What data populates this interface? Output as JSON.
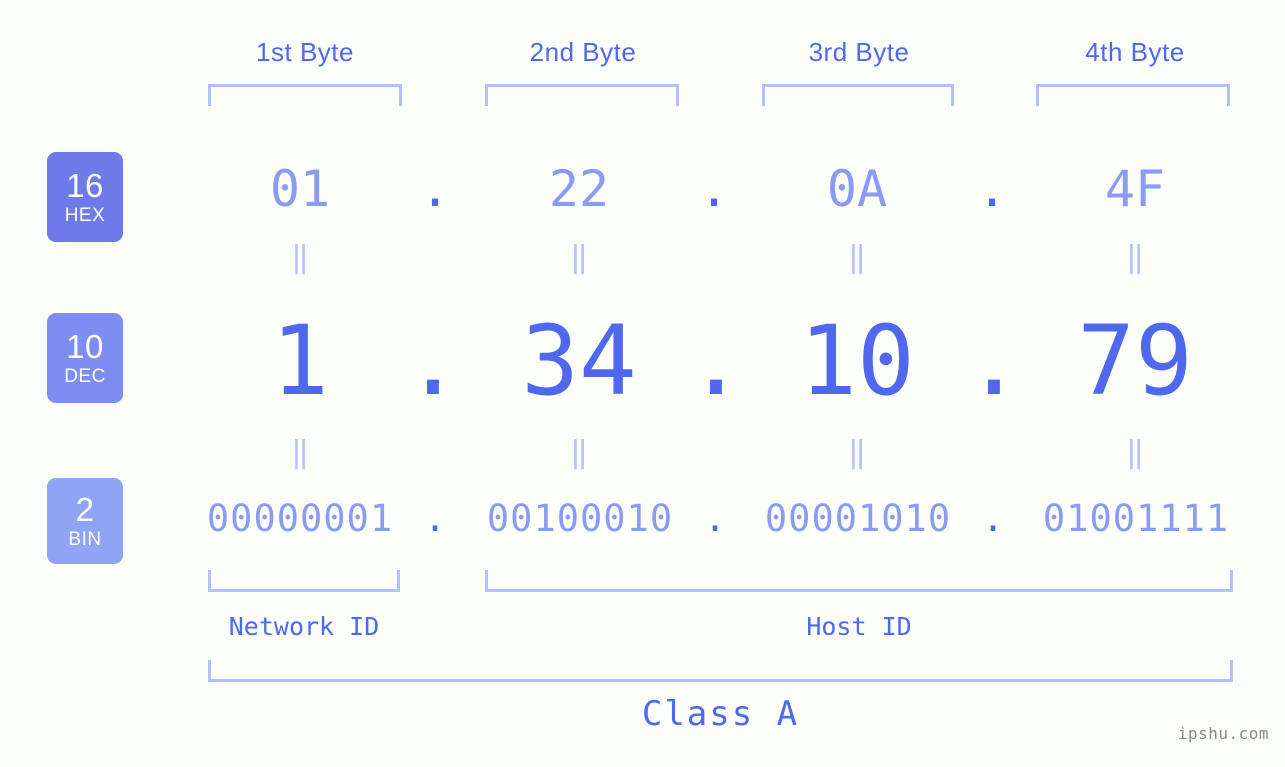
{
  "theme": {
    "background": "#fcfefa",
    "accent_strong": "#4f68ee",
    "accent_soft": "#8b9bf2",
    "bracket": "#b5c0fb",
    "badge_hex": "#6e7ae8",
    "badge_dec": "#7e8df0",
    "badge_bin": "#8fa4f5",
    "watermark": "#8a8a8a"
  },
  "headers": [
    {
      "label": "1st Byte"
    },
    {
      "label": "2nd Byte"
    },
    {
      "label": "3rd Byte"
    },
    {
      "label": "4th Byte"
    }
  ],
  "radix_badges": [
    {
      "num": "16",
      "word": "HEX"
    },
    {
      "num": "10",
      "word": "DEC"
    },
    {
      "num": "2",
      "word": "BIN"
    }
  ],
  "rows": {
    "hex": {
      "values": [
        "01",
        "22",
        "0A",
        "4F"
      ],
      "separator": "."
    },
    "dec": {
      "values": [
        "1",
        "34",
        "10",
        "79"
      ],
      "separator": "."
    },
    "bin": {
      "values": [
        "00000001",
        "00100010",
        "00001010",
        "01001111"
      ],
      "separator": "."
    }
  },
  "equals_symbol": "‖",
  "sections": [
    {
      "label": "Network ID"
    },
    {
      "label": "Host ID"
    }
  ],
  "class": {
    "label": "Class A"
  },
  "watermark": {
    "text": "ipshu.com"
  }
}
